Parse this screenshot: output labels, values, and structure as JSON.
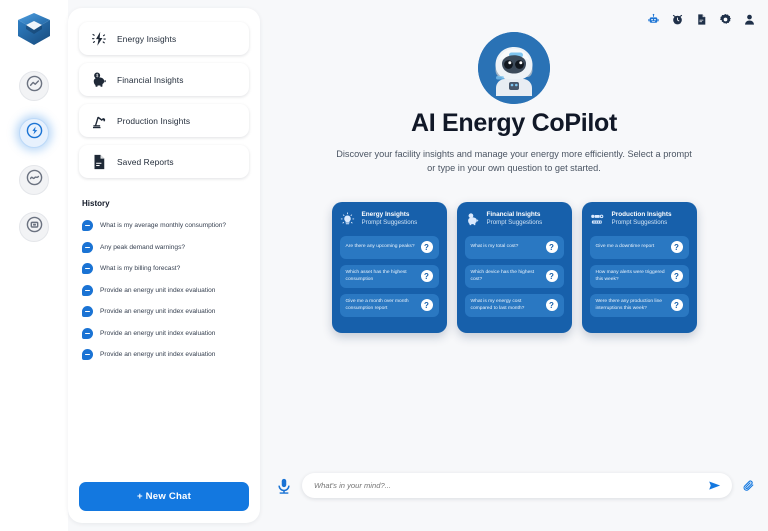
{
  "brand": {
    "logo_name": "hexagon-layers-logo",
    "accent": "#1378e0",
    "card_blue": "#1760ab",
    "pill_blue": "#2a78c2"
  },
  "rail": {
    "items": [
      {
        "name": "analytics-trend",
        "icon": "trend-up-icon",
        "active": false
      },
      {
        "name": "energy-ai",
        "icon": "energy-bolt-icon",
        "active": true
      },
      {
        "name": "monitoring",
        "icon": "wave-icon",
        "active": false
      },
      {
        "name": "reports",
        "icon": "display-icon",
        "active": false
      }
    ]
  },
  "sidebar": {
    "menu": [
      {
        "label": "Energy Insights",
        "icon": "energy-bolt-icon"
      },
      {
        "label": "Financial Insights",
        "icon": "piggy-bank-icon"
      },
      {
        "label": "Production Insights",
        "icon": "robot-arm-icon"
      },
      {
        "label": "Saved Reports",
        "icon": "document-icon"
      }
    ],
    "history_title": "History",
    "history": [
      "What is my average monthly consumption?",
      "Any peak demand warnings?",
      "What is my billing forecast?",
      "Provide an energy unit index evaluation",
      "Provide an energy unit index evaluation",
      "Provide an energy unit index evaluation",
      "Provide an energy unit index evaluation"
    ],
    "new_chat_label": "+ New Chat"
  },
  "topbar": {
    "icons": [
      {
        "name": "robot-icon",
        "active": true
      },
      {
        "name": "alarm-clock-icon",
        "active": false
      },
      {
        "name": "document-icon",
        "active": false
      },
      {
        "name": "gear-icon",
        "active": false
      },
      {
        "name": "user-icon",
        "active": false
      }
    ]
  },
  "hero": {
    "avatar_name": "ai-robot-avatar",
    "title": "AI Energy CoPilot",
    "subtitle": "Discover your facility insights and manage your energy more efficiently. Select a prompt or type in your own question to get started."
  },
  "cards": [
    {
      "title": "Energy Insights",
      "subtitle": "Prompt Suggestions",
      "icon": "energy-bulb-icon",
      "prompts": [
        "Are there any upcoming peaks?",
        "Which asset has the highest consumption",
        "Give me a month over month consumption report"
      ]
    },
    {
      "title": "Financial Insights",
      "subtitle": "Prompt Suggestions",
      "icon": "piggy-bank-icon",
      "prompts": [
        "What is my total cost?",
        "Which device has the highest cost?",
        "What is my energy cost compared to last month?"
      ]
    },
    {
      "title": "Production Insights",
      "subtitle": "Prompt Suggestions",
      "icon": "conveyor-icon",
      "prompts": [
        "Give me a downtime report",
        "How many alerts were triggered this week?",
        "Were there any production line interruptions this week?"
      ]
    }
  ],
  "composer": {
    "mic_icon": "microphone-icon",
    "placeholder": "What's in your mind?...",
    "value": "",
    "send_icon": "send-icon",
    "attach_icon": "paperclip-icon"
  },
  "badge_char": "?"
}
